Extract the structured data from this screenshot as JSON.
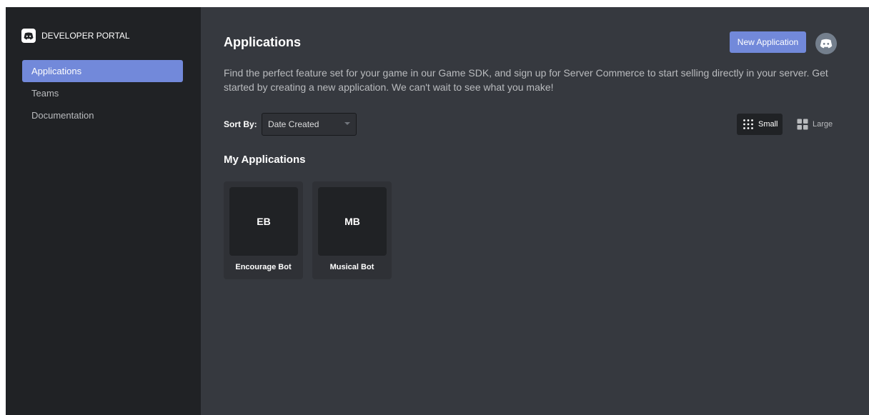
{
  "brand": {
    "title": "DEVELOPER PORTAL",
    "logo_icon": "discord-logo-icon"
  },
  "sidebar": {
    "items": [
      {
        "label": "Applications",
        "active": true
      },
      {
        "label": "Teams",
        "active": false
      },
      {
        "label": "Documentation",
        "active": false
      }
    ]
  },
  "header": {
    "title": "Applications",
    "new_app_label": "New Application",
    "avatar_icon": "discord-avatar-icon"
  },
  "description": "Find the perfect feature set for your game in our Game SDK, and sign up for Server Commerce to start selling directly in your server. Get started by creating a new application. We can't wait to see what you make!",
  "sort": {
    "label": "Sort By:",
    "selected": "Date Created"
  },
  "view_toggle": {
    "small_label": "Small",
    "large_label": "Large",
    "selected": "Small"
  },
  "my_apps": {
    "title": "My Applications",
    "apps": [
      {
        "initials": "EB",
        "name": "Encourage Bot"
      },
      {
        "initials": "MB",
        "name": "Musical Bot"
      }
    ]
  },
  "colors": {
    "accent": "#7289da",
    "sidebar_bg": "#202225",
    "main_bg": "#36393f",
    "card_bg": "#2f3136"
  }
}
